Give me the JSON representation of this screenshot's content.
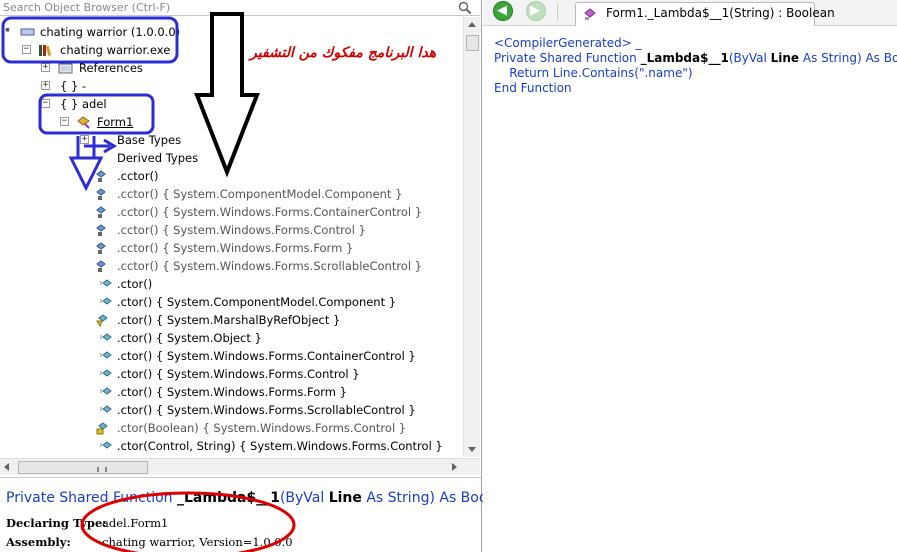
{
  "search": {
    "placeholder": "Search Object Browser (Ctrl-F)"
  },
  "tree": {
    "rows": [
      {
        "text": "chating warrior (1.0.0.0)"
      },
      {
        "text": "chating warrior.exe"
      },
      {
        "text": "References"
      },
      {
        "text": "{ }  -"
      },
      {
        "text": "{ }  adel"
      },
      {
        "text": "Form1"
      },
      {
        "text": "Base Types"
      },
      {
        "text": "Derived Types"
      },
      {
        "text": ".cctor()"
      },
      {
        "text": ".cctor() { System.ComponentModel.Component }"
      },
      {
        "text": ".cctor() { System.Windows.Forms.ContainerControl }"
      },
      {
        "text": ".cctor() { System.Windows.Forms.Control }"
      },
      {
        "text": ".cctor() { System.Windows.Forms.Form }"
      },
      {
        "text": ".cctor() { System.Windows.Forms.ScrollableControl }"
      },
      {
        "text": ".ctor()"
      },
      {
        "text": ".ctor() { System.ComponentModel.Component }"
      },
      {
        "text": ".ctor() { System.MarshalByRefObject }"
      },
      {
        "text": ".ctor() { System.Object }"
      },
      {
        "text": ".ctor() { System.Windows.Forms.ContainerControl }"
      },
      {
        "text": ".ctor() { System.Windows.Forms.Control }"
      },
      {
        "text": ".ctor() { System.Windows.Forms.Form }"
      },
      {
        "text": ".ctor() { System.Windows.Forms.ScrollableControl }"
      },
      {
        "text": ".ctor(Boolean) { System.Windows.Forms.Control }"
      },
      {
        "text": ".ctor(Control, String) { System.Windows.Forms.Control }"
      }
    ]
  },
  "details": {
    "signature": {
      "p1": "Private Shared Function ",
      "name": "_Lambda$__1",
      "p2": "(ByVal ",
      "param": "Line",
      "p3": " As ",
      "type": "String",
      "p4": ") As Boole"
    },
    "declaring_label": "Declaring Type:",
    "declaring_value": "adel.Form1",
    "assembly_label": "Assembly:",
    "assembly_value": "chating warrior, Version=1.0.0.0"
  },
  "toolbar": {
    "back_icon": "arrow-left-icon",
    "forward_icon": "arrow-right-icon",
    "tab_label": "Form1._Lambda$__1(String) : Boolean"
  },
  "code": {
    "line1_attr": "<CompilerGenerated> _",
    "line2_a": "Private Shared Function ",
    "line2_name": "_Lambda$__1",
    "line2_b": "(ByVal ",
    "line2_param": "Line",
    "line2_c": " As String) As Boolean",
    "line3": "    Return Line.Contains(\".name\")",
    "line4": "End Function"
  },
  "annotation": {
    "arabic_text": "هدا البرنامج مفكوك من التشفير"
  },
  "colors": {
    "keyword_blue": "#1a3dc8",
    "annotation_blue": "#2c2cd6",
    "annotation_red": "#e00000",
    "annotation_black": "#000000"
  }
}
